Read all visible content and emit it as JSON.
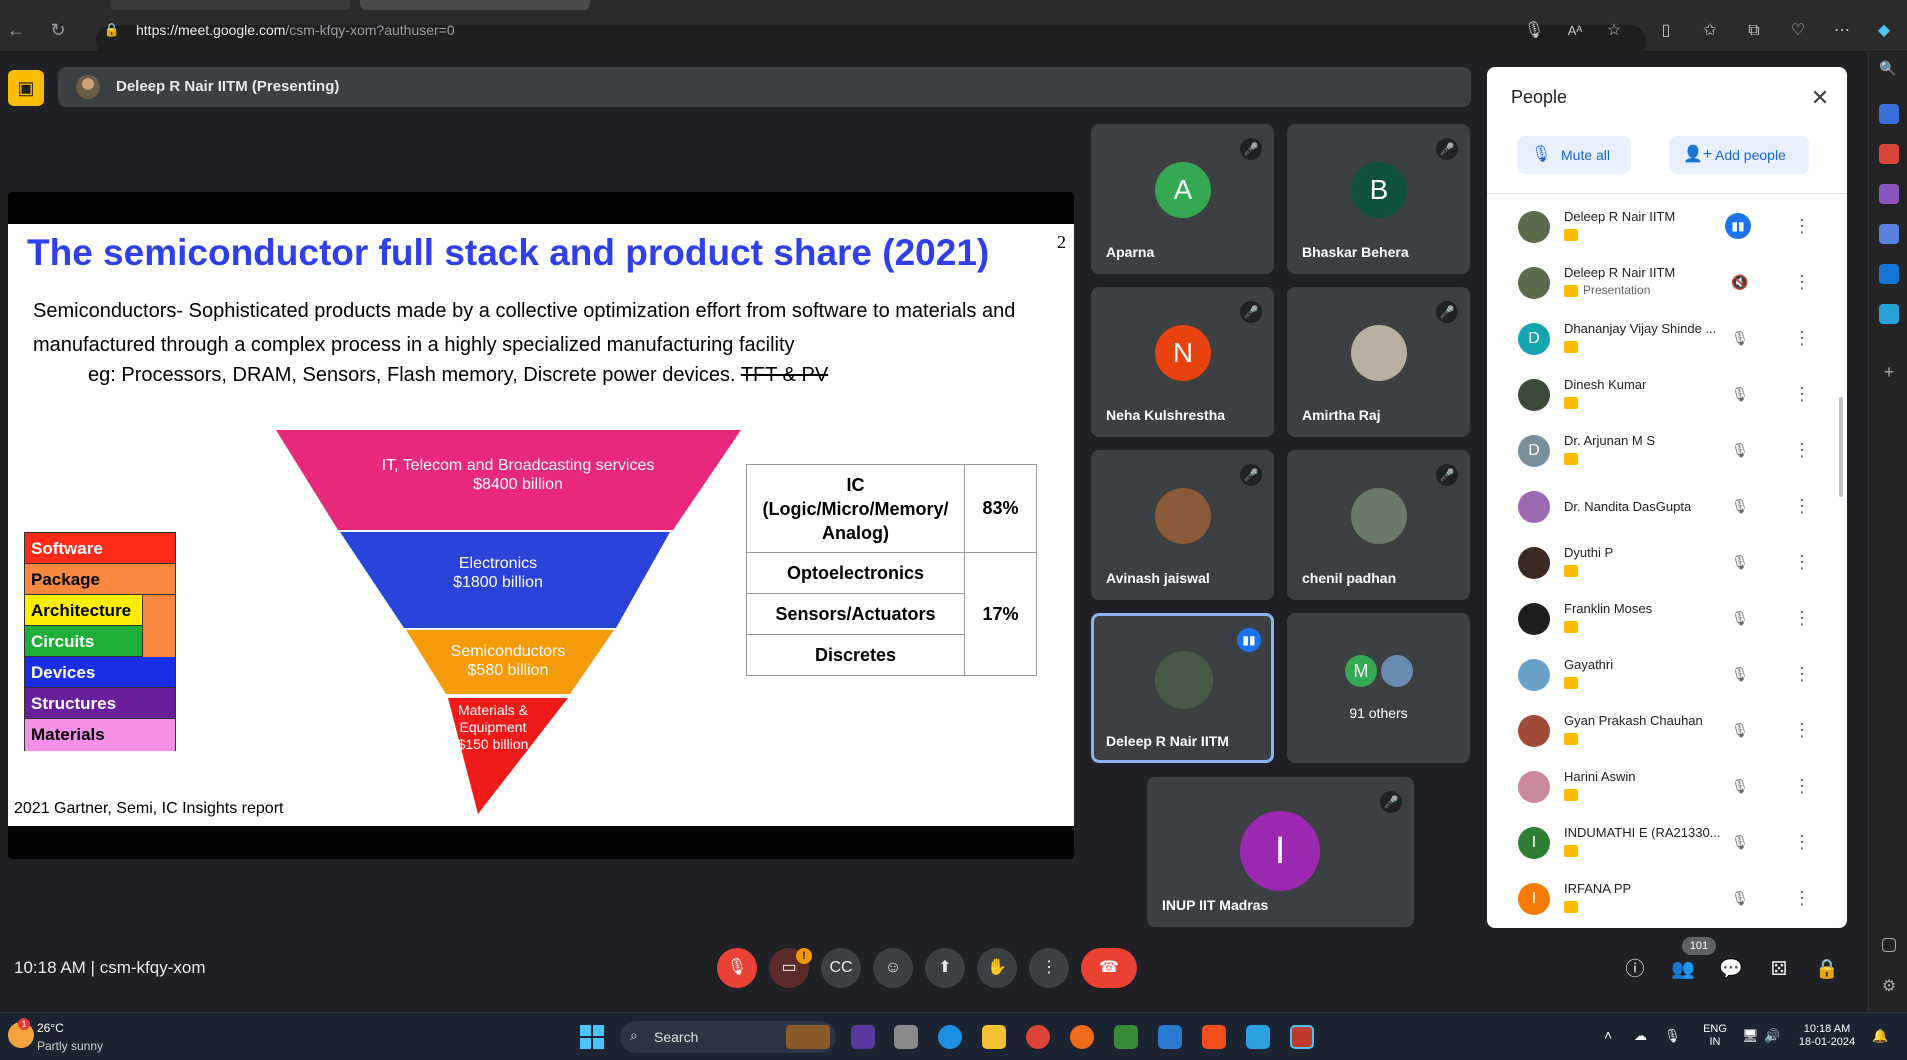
{
  "browser": {
    "url_host": "https://meet.google.com",
    "url_path": "/csm-kfqy-xom?authuser=0"
  },
  "presenting_bar": {
    "text": "Deleep R Nair IITM (Presenting)"
  },
  "slide": {
    "title": "The semiconductor full stack and product share (2021)",
    "page_number": "2",
    "line1": "Semiconductors- Sophisticated products made by a collective optimization effort from software to materials and",
    "line2": "manufactured through a complex process in a highly specialized manufacturing facility",
    "line3_prefix": "eg: Processors, DRAM, Sensors, Flash memory, Discrete power devices.",
    "line3_struck": "TFT & PV",
    "source": "2021 Gartner,  Semi, IC Insights report",
    "pyramid": [
      {
        "line1": "IT, Telecom and Broadcasting services",
        "line2": "$8400 billion",
        "color": "#e8287a"
      },
      {
        "line1": "Electronics",
        "line2": "$1800 billion",
        "color": "#2942d8"
      },
      {
        "line1": "Semiconductors",
        "line2": "$580 billion",
        "color": "#f59b0a"
      },
      {
        "line1": "Materials &",
        "line2": "Equipment",
        "line3": "$150 billion",
        "color": "#ef1a1a"
      }
    ],
    "stack": [
      {
        "label": "Software",
        "color": "#ff2a1a"
      },
      {
        "label": "Package",
        "color": "#f7883e"
      },
      {
        "label": "Architecture",
        "color": "#ffee00"
      },
      {
        "label": "Circuits",
        "color": "#1fae3a"
      },
      {
        "label": "Devices",
        "color": "#1a2ee8"
      },
      {
        "label": "Structures",
        "color": "#6b1e9a"
      },
      {
        "label": "Materials",
        "color": "#f690e6"
      }
    ],
    "table": {
      "ic_line1": "IC",
      "ic_line2": "(Logic/Micro/Memory/",
      "ic_line3": "Analog)",
      "ic_share": "83%",
      "opto": "Optoelectronics",
      "sensors": "Sensors/Actuators",
      "others_share": "17%",
      "discretes": "Discretes"
    }
  },
  "tiles": [
    {
      "name": "Aparna",
      "initial": "A",
      "color": "#34a853"
    },
    {
      "name": "Bhaskar Behera",
      "initial": "B",
      "color": "#0f5041"
    },
    {
      "name": "Neha Kulshrestha",
      "initial": "N",
      "color": "#e8430e"
    },
    {
      "name": "Amirtha Raj",
      "initial": "",
      "color": "#b7b0a0"
    },
    {
      "name": "Avinash jaiswal",
      "initial": "",
      "color": "#8a5a3a"
    },
    {
      "name": "chenil padhan",
      "initial": "",
      "color": "#6a7a6a"
    },
    {
      "name": "Deleep R Nair IITM",
      "initial": "",
      "color": "#4a5a48"
    },
    {
      "name": "91 others",
      "initial": "M",
      "color": "#34a853"
    },
    {
      "name": "INUP IIT Madras",
      "initial": "I",
      "color": "#9c27b0"
    }
  ],
  "people_panel": {
    "title": "People",
    "mute_all": "Mute all",
    "add_people": "Add people",
    "people": [
      {
        "name": "Deleep R Nair IITM",
        "sub": "",
        "initial": "",
        "color": "#5a6a4a"
      },
      {
        "name": "Deleep R Nair IITM",
        "sub": "Presentation",
        "initial": "",
        "color": "#5a6a4a"
      },
      {
        "name": "Dhananjay Vijay Shinde ...",
        "sub": "",
        "initial": "D",
        "color": "#12a4af"
      },
      {
        "name": "Dinesh Kumar",
        "sub": "",
        "initial": "",
        "color": "#3c4a3c"
      },
      {
        "name": "Dr. Arjunan M S",
        "sub": "",
        "initial": "D",
        "color": "#78909c"
      },
      {
        "name": "Dr. Nandita DasGupta",
        "sub": "",
        "initial": "",
        "color": "#9c6ab0"
      },
      {
        "name": "Dyuthi P",
        "sub": "",
        "initial": "",
        "color": "#3a2a22"
      },
      {
        "name": "Franklin Moses",
        "sub": "",
        "initial": "",
        "color": "#1e1e1e"
      },
      {
        "name": "Gayathri",
        "sub": "",
        "initial": "",
        "color": "#6aa0c8"
      },
      {
        "name": "Gyan Prakash Chauhan",
        "sub": "",
        "initial": "",
        "color": "#a04a3a"
      },
      {
        "name": "Harini Aswin",
        "sub": "",
        "initial": "",
        "color": "#c88a9a"
      },
      {
        "name": "INDUMATHI E (RA21330...",
        "sub": "",
        "initial": "I",
        "color": "#2e7d32"
      },
      {
        "name": "IRFANA PP",
        "sub": "",
        "initial": "I",
        "color": "#f57c00"
      }
    ]
  },
  "bottom_bar": {
    "time": "10:18 AM",
    "meeting_code": "csm-kfqy-xom",
    "people_count": "101"
  },
  "taskbar": {
    "temperature": "26°C",
    "weather": "Partly sunny",
    "search": "Search",
    "lang_line1": "ENG",
    "lang_line2": "IN",
    "clock_time": "10:18 AM",
    "clock_date": "18-01-2024",
    "weather_badge": "1"
  }
}
